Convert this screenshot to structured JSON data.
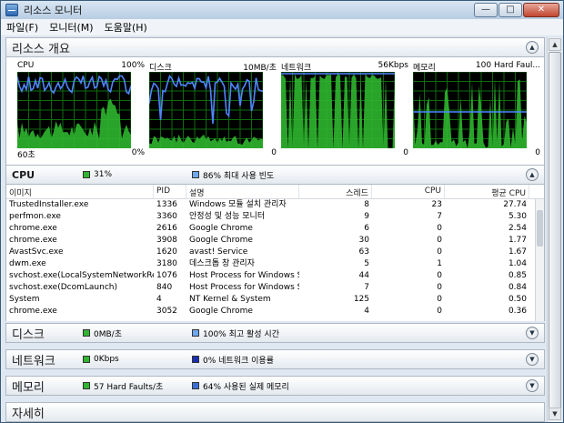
{
  "window": {
    "title": "리소스 모니터"
  },
  "window_buttons": {
    "minimize": "—",
    "maximize": "□",
    "close": "✕"
  },
  "menu": [
    "파일(F)",
    "모니터(M)",
    "도움말(H)"
  ],
  "overview": {
    "title": "리소스 개요",
    "graphs": [
      {
        "name": "CPU",
        "scale": "100%",
        "bottom_left": "60초",
        "bottom_right": "0%",
        "line_color": "#4f86ff",
        "fill_color": "#2fb52f"
      },
      {
        "name": "디스크",
        "scale": "10MB/초",
        "bottom_left": "",
        "bottom_right": "0",
        "line_color": "#4f86ff",
        "fill_color": "#2fb52f"
      },
      {
        "name": "네트워크",
        "scale": "56Kbps",
        "bottom_left": "",
        "bottom_right": "0",
        "line_color": "#4f86ff",
        "fill_color": "#2fb52f"
      },
      {
        "name": "메모리",
        "scale": "100 Hard Faul...",
        "bottom_left": "",
        "bottom_right": "0",
        "line_color": "#4f86ff",
        "fill_color": "#2fb52f"
      }
    ]
  },
  "cpu_section": {
    "title": "CPU",
    "stat1": "31%",
    "stat1_color": "#2fb52f",
    "stat2": "86% 최대 사용 빈도",
    "stat2_color": "#6fa8f0",
    "columns": [
      "이미지",
      "PID",
      "설명",
      "스레드",
      "CPU",
      "평균 CPU"
    ],
    "rows": [
      [
        "TrustedInstaller.exe",
        "1336",
        "Windows 모듈 설치 관리자",
        "8",
        "23",
        "27.74"
      ],
      [
        "perfmon.exe",
        "3360",
        "안정성 및 성능 모니터",
        "9",
        "7",
        "5.30"
      ],
      [
        "chrome.exe",
        "2616",
        "Google Chrome",
        "6",
        "0",
        "2.54"
      ],
      [
        "chrome.exe",
        "3908",
        "Google Chrome",
        "30",
        "0",
        "1.77"
      ],
      [
        "AvastSvc.exe",
        "1620",
        "avast! Service",
        "63",
        "0",
        "1.67"
      ],
      [
        "dwm.exe",
        "3180",
        "데스크톱 창 관리자",
        "5",
        "1",
        "1.04"
      ],
      [
        "svchost.exe(LocalSystemNetworkRestr...",
        "1076",
        "Host Process for Windows S...",
        "44",
        "0",
        "0.85"
      ],
      [
        "svchost.exe(DcomLaunch)",
        "840",
        "Host Process for Windows S...",
        "7",
        "0",
        "0.84"
      ],
      [
        "System",
        "4",
        "NT Kernel & System",
        "125",
        "0",
        "0.50"
      ],
      [
        "chrome.exe",
        "3052",
        "Google Chrome",
        "4",
        "0",
        "0.36"
      ]
    ]
  },
  "disk_section": {
    "title": "디스크",
    "stat1": "0MB/초",
    "stat1_color": "#2fb52f",
    "stat2": "100% 최고 활성 시간",
    "stat2_color": "#6fa8f0"
  },
  "network_section": {
    "title": "네트워크",
    "stat1": "0Kbps",
    "stat1_color": "#2fb52f",
    "stat2": "0% 네트워크 이용률",
    "stat2_color": "#1a2fb0"
  },
  "memory_section": {
    "title": "메모리",
    "stat1": "57 Hard Faults/초",
    "stat1_color": "#2fb52f",
    "stat2": "64% 사용된 실제 메모리",
    "stat2_color": "#3b6fd6"
  },
  "detail_section": {
    "title": "자세히"
  }
}
